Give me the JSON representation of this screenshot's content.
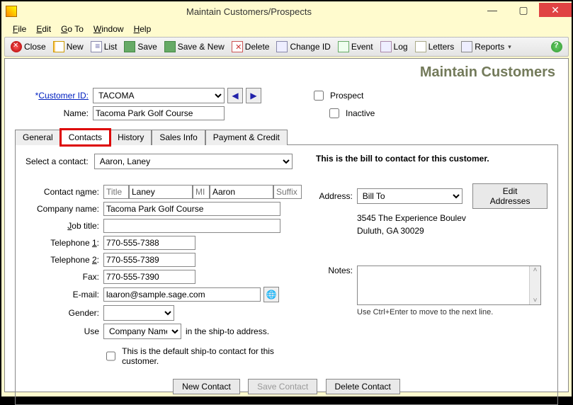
{
  "window": {
    "title": "Maintain Customers/Prospects"
  },
  "menu": {
    "file": "File",
    "edit": "Edit",
    "goto": "Go To",
    "window": "Window",
    "help": "Help"
  },
  "toolbar": {
    "close": "Close",
    "new": "New",
    "list": "List",
    "save": "Save",
    "savenew": "Save & New",
    "delete": "Delete",
    "changeid": "Change ID",
    "event": "Event",
    "log": "Log",
    "letters": "Letters",
    "reports": "Reports"
  },
  "heading": "Maintain Customers",
  "header": {
    "customer_id_label": "Customer ID:",
    "customer_id": "TACOMA",
    "name_label": "Name:",
    "name": "Tacoma Park Golf Course",
    "prospect_label": "Prospect",
    "inactive_label": "Inactive",
    "prospect": false,
    "inactive": false
  },
  "tabs": {
    "general": "General",
    "contacts": "Contacts",
    "history": "History",
    "sales": "Sales Info",
    "payment": "Payment & Credit"
  },
  "contact": {
    "select_label": "Select a contact:",
    "selected": "Aaron, Laney",
    "billto_heading": "This is the bill to contact for this customer.",
    "name_label": "Contact name:",
    "title_ph": "Title",
    "last": "Laney",
    "mi_ph": "MI",
    "first": "Aaron",
    "suffix_ph": "Suffix",
    "company_label": "Company name:",
    "company": "Tacoma Park Golf Course",
    "job_label": "Job title:",
    "job": "",
    "tel1_label": "Telephone 1:",
    "tel1": "770-555-7388",
    "tel2_label": "Telephone 2:",
    "tel2": "770-555-7389",
    "fax_label": "Fax:",
    "fax": "770-555-7390",
    "email_label": "E-mail:",
    "email": "laaron@sample.sage.com",
    "gender_label": "Gender:",
    "gender": "",
    "use_label": "Use",
    "use_value": "Company Name",
    "use_suffix": "in the ship-to address.",
    "default_ship_label": "This is the default ship-to contact for this customer.",
    "default_ship": false
  },
  "address": {
    "label": "Address:",
    "type": "Bill To",
    "edit_btn": "Edit Addresses",
    "line1": "3545 The Experience Boulev",
    "line2": "Duluth, GA 30029"
  },
  "notes": {
    "label": "Notes:",
    "hint": "Use Ctrl+Enter to move to the next line."
  },
  "buttons": {
    "new": "New Contact",
    "save": "Save Contact",
    "delete": "Delete Contact"
  }
}
